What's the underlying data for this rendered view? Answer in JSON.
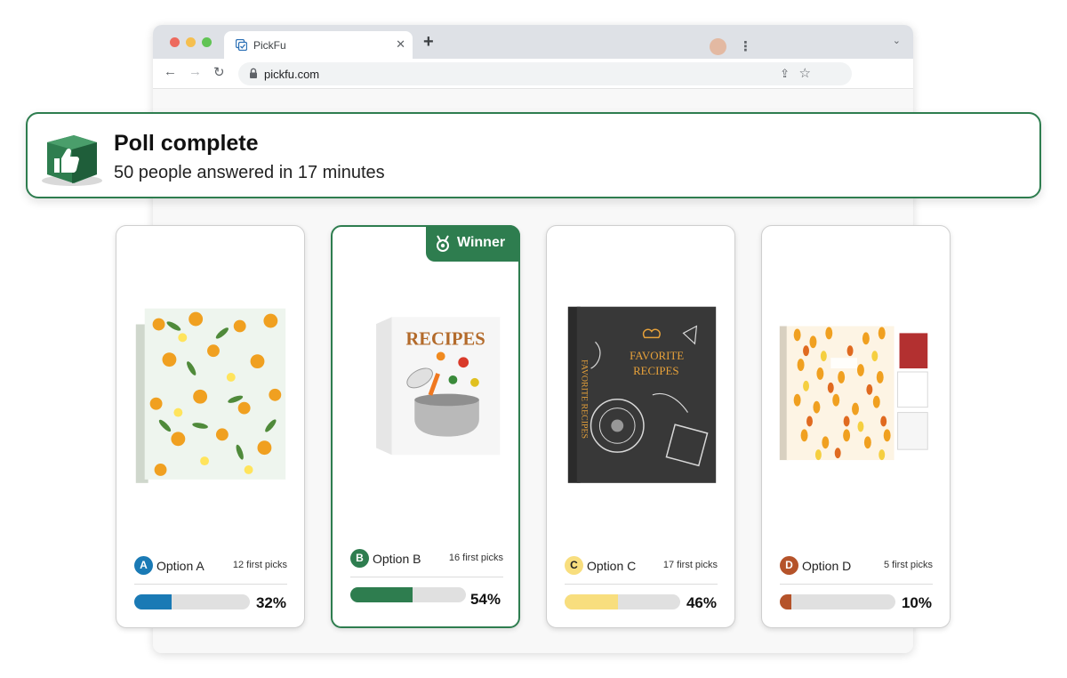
{
  "browser": {
    "tab_title": "PickFu",
    "url": "pickfu.com"
  },
  "banner": {
    "title": "Poll complete",
    "subtitle": "50 people answered in 17 minutes",
    "icon": "thumbs-up-cube-icon"
  },
  "winner_label": "Winner",
  "options": [
    {
      "letter": "A",
      "name": "Option A",
      "picks": "12 first picks",
      "percent": "32%",
      "fill_fraction": 0.32,
      "color": "#1a7ab5",
      "letter_text_color": "#ffffff"
    },
    {
      "letter": "B",
      "name": "Option B",
      "picks": "16 first picks",
      "percent": "54%",
      "fill_fraction": 0.54,
      "color": "#2e7d4f",
      "letter_text_color": "#ffffff",
      "winner": true
    },
    {
      "letter": "C",
      "name": "Option C",
      "picks": "17 first picks",
      "percent": "46%",
      "fill_fraction": 0.46,
      "color": "#f8de7e",
      "letter_text_color": "#222222"
    },
    {
      "letter": "D",
      "name": "Option D",
      "picks": "5 first picks",
      "percent": "10%",
      "fill_fraction": 0.1,
      "color": "#b5532a",
      "letter_text_color": "#ffffff"
    }
  ],
  "colors": {
    "accent_green": "#2e7d4f"
  }
}
